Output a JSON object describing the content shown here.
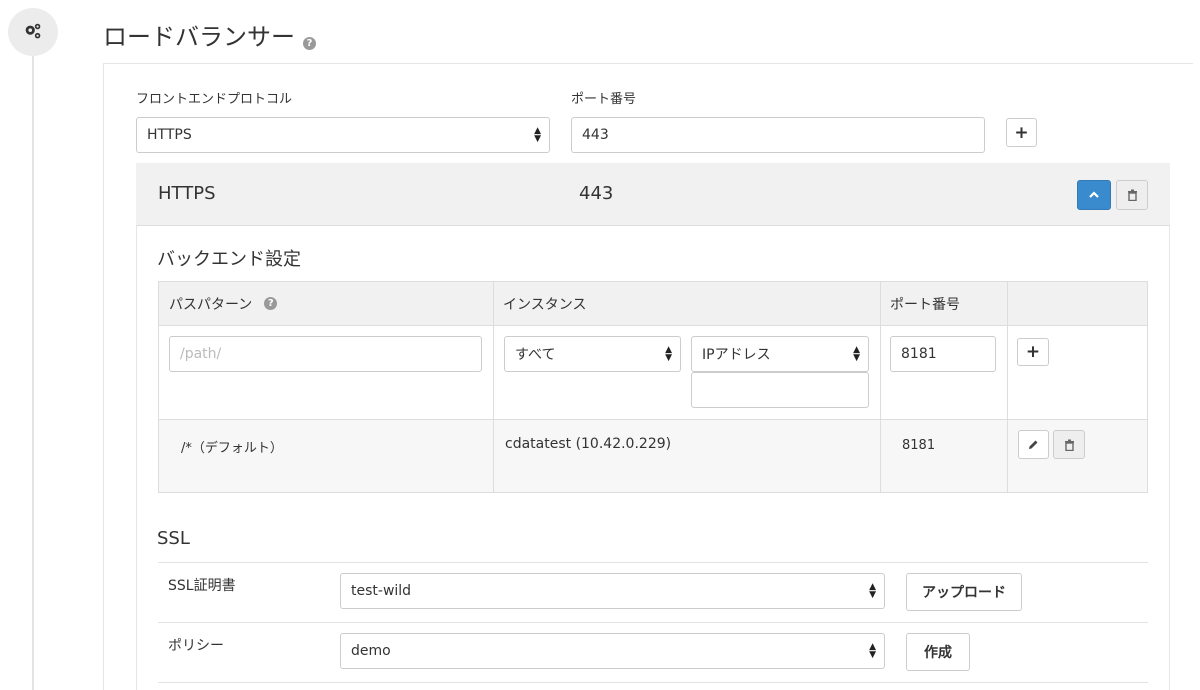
{
  "page": {
    "title": "ロードバランサー"
  },
  "frontend": {
    "protocol_label": "フロントエンドプロトコル",
    "protocol_value": "HTTPS",
    "port_label": "ポート番号",
    "port_value": "443"
  },
  "listener": {
    "protocol": "HTTPS",
    "port": "443"
  },
  "backend": {
    "title": "バックエンド設定",
    "columns": {
      "path": "パスパターン",
      "instance": "インスタンス",
      "port": "ポート番号"
    },
    "new_row": {
      "path_placeholder": "/path/",
      "instance_filter": "すべて",
      "instance_type": "IPアドレス",
      "instance_value": "",
      "port": "8181"
    },
    "default_row": {
      "path": "/*（デフォルト）",
      "instance": "cdatatest (10.42.0.229)",
      "port": "8181"
    }
  },
  "ssl": {
    "title": "SSL",
    "certificate_label": "SSL証明書",
    "certificate_value": "test-wild",
    "upload_label": "アップロード",
    "policy_label": "ポリシー",
    "policy_value": "demo",
    "create_label": "作成"
  },
  "colors": {
    "accent": "#3a8bcd",
    "header_bg": "#f1f1f1"
  }
}
